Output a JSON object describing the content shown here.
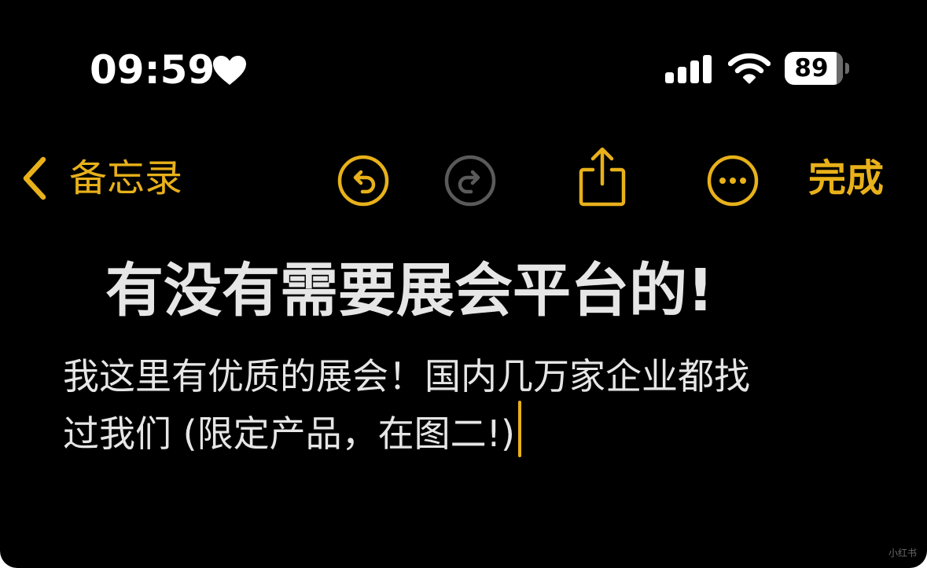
{
  "status_bar": {
    "time": "09:59",
    "battery_level": "89",
    "heart_icon": "heart-icon",
    "signal_icon": "cellular-signal-icon",
    "wifi_icon": "wifi-icon",
    "battery_icon": "battery-icon"
  },
  "toolbar": {
    "back_label": "备忘录",
    "back_icon": "chevron-left-icon",
    "undo_icon": "undo-icon",
    "redo_icon": "redo-icon",
    "share_icon": "share-icon",
    "more_icon": "ellipsis-circle-icon",
    "done_label": "完成"
  },
  "note": {
    "title": "有没有需要展会平台的!",
    "body_lines": [
      "我这里有优质的展会！国内几万家企业都找",
      "过我们 (限定产品，在图二!)"
    ]
  },
  "watermark": "小红书",
  "colors": {
    "background": "#000000",
    "accent": "#e8b11a",
    "text": "#e6e6e6",
    "disabled": "#5a5a5a"
  }
}
